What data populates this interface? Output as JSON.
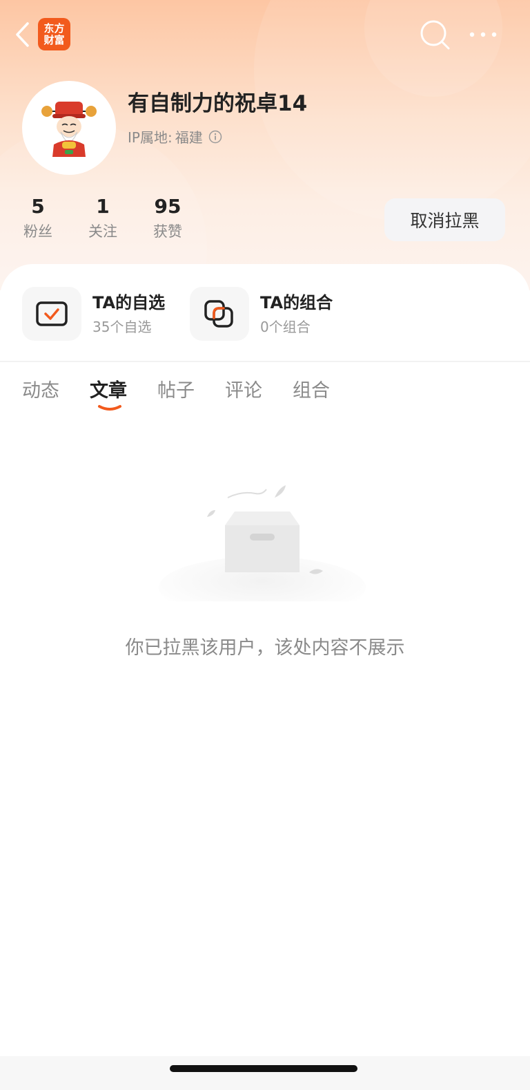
{
  "app": {
    "logo_line1": "东方",
    "logo_line2": "财富",
    "brand_color": "#f25a1d"
  },
  "profile": {
    "name": "有自制力的祝卓14",
    "ip_label": "IP属地:",
    "ip_value": "福建"
  },
  "stats": [
    {
      "value": "5",
      "label": "粉丝"
    },
    {
      "value": "1",
      "label": "关注"
    },
    {
      "value": "95",
      "label": "获赞"
    }
  ],
  "actions": {
    "unblock_label": "取消拉黑"
  },
  "features": [
    {
      "title": "TA的自选",
      "subtitle": "35个自选",
      "icon": "watchlist-check-icon"
    },
    {
      "title": "TA的组合",
      "subtitle": "0个组合",
      "icon": "portfolio-icon"
    }
  ],
  "tabs": [
    {
      "label": "动态",
      "active": false
    },
    {
      "label": "文章",
      "active": true
    },
    {
      "label": "帖子",
      "active": false
    },
    {
      "label": "评论",
      "active": false
    },
    {
      "label": "组合",
      "active": false
    }
  ],
  "empty_state": {
    "message": "你已拉黑该用户，该处内容不展示",
    "icon": "empty-box-icon"
  },
  "icons": {
    "back": "chevron-left-icon",
    "search": "search-icon",
    "more": "more-dots-icon",
    "info": "info-icon"
  },
  "colors": {
    "accent": "#f25a1d",
    "tab_indicator": "#f25a1d"
  }
}
